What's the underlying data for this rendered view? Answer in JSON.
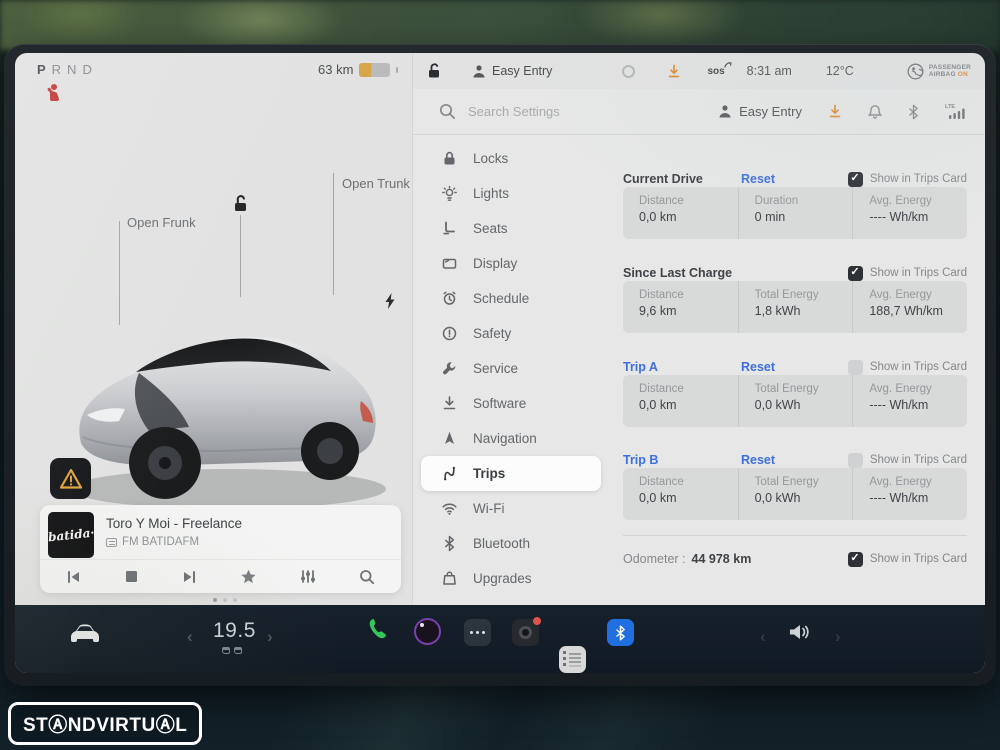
{
  "colors": {
    "accent_blue": "#3d6fe0",
    "warning_orange": "#e0892f",
    "alert_red": "#c23a38",
    "phone_green": "#35c759",
    "bluetooth_blue": "#1f6fe0",
    "battery_low_yellow": "#d7a64a"
  },
  "status_bar": {
    "gear_selected": "P",
    "gears_rest": "RND",
    "range": "63 km",
    "profile": "Easy Entry",
    "sos": "sos",
    "time": "8:31 am",
    "outside_temp": "12°C",
    "airbag_line1": "PASSENGER",
    "airbag_line2": "AIRBAG",
    "airbag_state": "ON"
  },
  "car_view": {
    "open_frunk": "Open Frunk",
    "open_trunk": "Open Trunk",
    "icons": [
      "unlocked-icon",
      "charge-port-bolt-icon",
      "seatbelt-warning-icon",
      "hazard-warning-icon"
    ]
  },
  "media": {
    "art_label": "batida·",
    "title": "Toro Y Moi - Freelance",
    "source": "FM BATIDAFM",
    "controls": [
      "previous-icon",
      "stop-icon",
      "next-icon",
      "favorite-icon",
      "equalizer-icon",
      "search-icon"
    ]
  },
  "settings": {
    "search_placeholder": "Search Settings",
    "profile": "Easy Entry",
    "header_icons": [
      "profile-icon",
      "download-icon",
      "bell-icon",
      "bluetooth-icon",
      "lte-signal-icon"
    ],
    "sidebar": [
      {
        "label": "Locks",
        "icon": "lock-icon"
      },
      {
        "label": "Lights",
        "icon": "light-icon"
      },
      {
        "label": "Seats",
        "icon": "seat-icon"
      },
      {
        "label": "Display",
        "icon": "display-icon"
      },
      {
        "label": "Schedule",
        "icon": "schedule-icon"
      },
      {
        "label": "Safety",
        "icon": "safety-icon"
      },
      {
        "label": "Service",
        "icon": "service-icon"
      },
      {
        "label": "Software",
        "icon": "software-icon"
      },
      {
        "label": "Navigation",
        "icon": "navigation-icon"
      },
      {
        "label": "Trips",
        "icon": "trips-icon",
        "selected": true
      },
      {
        "label": "Wi-Fi",
        "icon": "wifi-icon"
      },
      {
        "label": "Bluetooth",
        "icon": "bluetooth-icon"
      },
      {
        "label": "Upgrades",
        "icon": "upgrades-icon"
      }
    ],
    "sections": [
      {
        "title": "Current Drive",
        "reset": "Reset",
        "show_label": "Show in Trips Card",
        "checked": true,
        "cols": [
          {
            "label": "Distance",
            "value": "0,0 km"
          },
          {
            "label": "Duration",
            "value": "0 min"
          },
          {
            "label": "Avg. Energy",
            "value": "---- Wh/km"
          }
        ]
      },
      {
        "title": "Since Last Charge",
        "show_label": "Show in Trips Card",
        "checked": true,
        "cols": [
          {
            "label": "Distance",
            "value": "9,6 km"
          },
          {
            "label": "Total Energy",
            "value": "1,8 kWh"
          },
          {
            "label": "Avg. Energy",
            "value": "188,7 Wh/km"
          }
        ]
      },
      {
        "title": "Trip A",
        "reset": "Reset",
        "show_label": "Show in Trips Card",
        "checked": false,
        "cols": [
          {
            "label": "Distance",
            "value": "0,0 km"
          },
          {
            "label": "Total Energy",
            "value": "0,0 kWh"
          },
          {
            "label": "Avg. Energy",
            "value": "---- Wh/km"
          }
        ]
      },
      {
        "title": "Trip B",
        "reset": "Reset",
        "show_label": "Show in Trips Card",
        "checked": false,
        "cols": [
          {
            "label": "Distance",
            "value": "0,0 km"
          },
          {
            "label": "Total Energy",
            "value": "0,0 kWh"
          },
          {
            "label": "Avg. Energy",
            "value": "---- Wh/km"
          }
        ]
      }
    ],
    "odometer_label": "Odometer :",
    "odometer_value": "44 978 km",
    "odometer_show": "Show in Trips Card",
    "odometer_checked": true
  },
  "dock": {
    "temp": "19.5",
    "apps": [
      "car-icon",
      "phone-icon",
      "voice-icon",
      "more-apps-icon",
      "dashcam-icon",
      "calendar-icon",
      "bluetooth-app-icon",
      "radio-icon",
      "volume-icon"
    ]
  },
  "watermark": {
    "text": "STⒶNDVIRTUⒶL"
  }
}
